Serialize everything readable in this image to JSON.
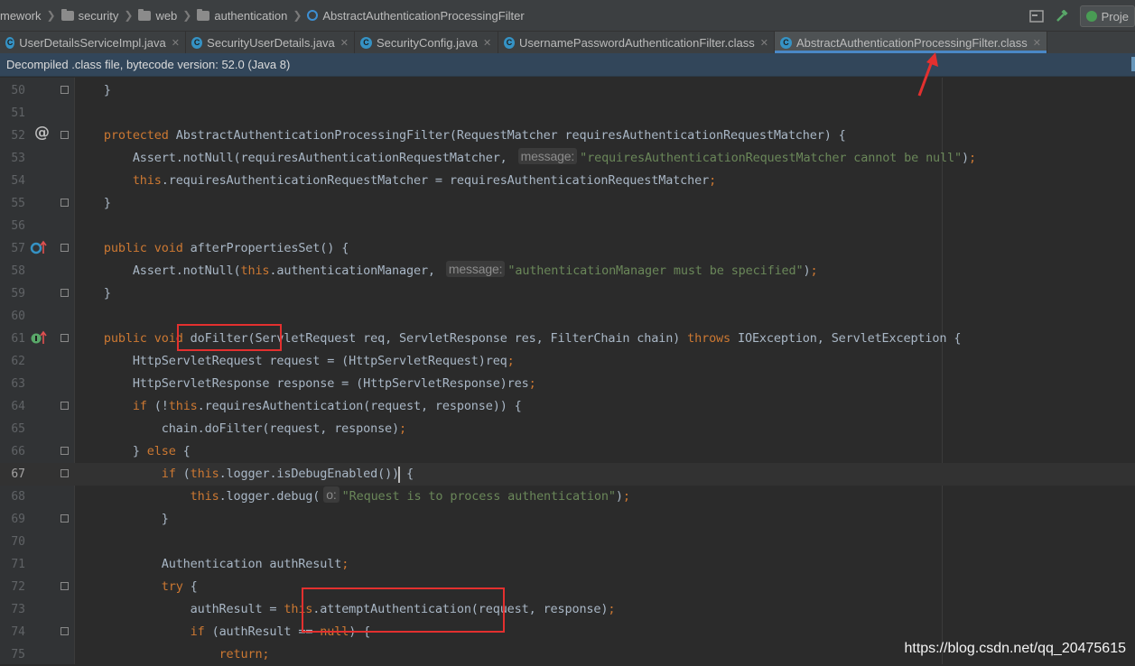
{
  "breadcrumbs": [
    "mework",
    "security",
    "web",
    "authentication",
    "AbstractAuthenticationProcessingFilter"
  ],
  "nav_right": {
    "run_label": "Proje"
  },
  "tabs": [
    {
      "label": "UserDetailsServiceImpl.java",
      "active": false
    },
    {
      "label": "SecurityUserDetails.java",
      "active": false
    },
    {
      "label": "SecurityConfig.java",
      "active": false
    },
    {
      "label": "UsernamePasswordAuthenticationFilter.class",
      "active": false
    },
    {
      "label": "AbstractAuthenticationProcessingFilter.class",
      "active": true
    }
  ],
  "banner": {
    "text": "Decompiled .class file, bytecode version: 52.0 (Java 8)"
  },
  "editor": {
    "current_line": 67,
    "line_numbers": [
      "50",
      "51",
      "52",
      "53",
      "54",
      "55",
      "56",
      "57",
      "58",
      "59",
      "60",
      "61",
      "62",
      "63",
      "64",
      "65",
      "66",
      "67",
      "68",
      "69",
      "70",
      "71",
      "72",
      "73",
      "74",
      "75"
    ]
  },
  "gutter_icons": {
    "line52": "@",
    "line57": "override-icon",
    "line61": "implement-icon"
  },
  "hints": {
    "message1": "message:",
    "message2": "message:",
    "o": "o:"
  },
  "watermark": "https://blog.csdn.net/qq_20475615",
  "colors": {
    "keyword": "#cc7832",
    "string": "#6a8759",
    "text": "#a9b7c6",
    "highlight_box": "#e3302f",
    "active_tab_underline": "#4a88c7"
  }
}
